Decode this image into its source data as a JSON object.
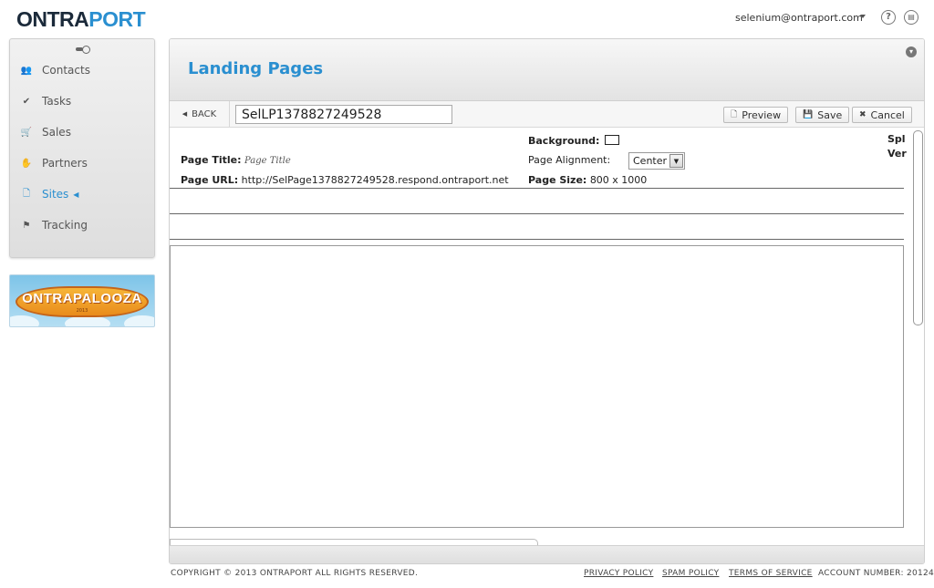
{
  "header": {
    "logo_left": "ONTRA",
    "logo_right": "PORT",
    "user_email": "selenium@ontraport.com",
    "help_icon": "question-circle",
    "info_icon": "document-circle"
  },
  "sidebar": {
    "items": [
      {
        "label": "Contacts",
        "icon": "contacts-icon"
      },
      {
        "label": "Tasks",
        "icon": "check-icon"
      },
      {
        "label": "Sales",
        "icon": "cart-icon"
      },
      {
        "label": "Partners",
        "icon": "handshake-icon"
      },
      {
        "label": "Sites",
        "icon": "page-icon",
        "active": true
      },
      {
        "label": "Tracking",
        "icon": "flag-icon"
      }
    ],
    "promo": {
      "title": "ONTRAPALOOZA",
      "year": "2013"
    }
  },
  "main": {
    "heading": "Landing Pages",
    "toolbar": {
      "back_label": "BACK",
      "page_name": "SelLP1378827249528",
      "preview_label": "Preview",
      "save_label": "Save",
      "cancel_label": "Cancel"
    },
    "props": {
      "page_title_label": "Page Title:",
      "page_title_value": "Page Title",
      "page_url_label": "Page URL:",
      "page_url_value": "http://SelPage1378827249528.respond.ontraport.net",
      "background_label": "Background:",
      "background_color": "#ffffff",
      "alignment_label": "Page Alignment:",
      "alignment_value": "Center",
      "size_label": "Page Size:",
      "size_value": "800 x 1000",
      "clipped_1": "Spl",
      "clipped_2": "Ver"
    }
  },
  "footer": {
    "copyright": "COPYRIGHT © 2013 ONTRAPORT ALL RIGHTS RESERVED.",
    "privacy": "PRIVACY POLICY",
    "spam": "SPAM POLICY",
    "terms": "TERMS OF SERVICE",
    "account": "ACCOUNT NUMBER: 20124"
  }
}
